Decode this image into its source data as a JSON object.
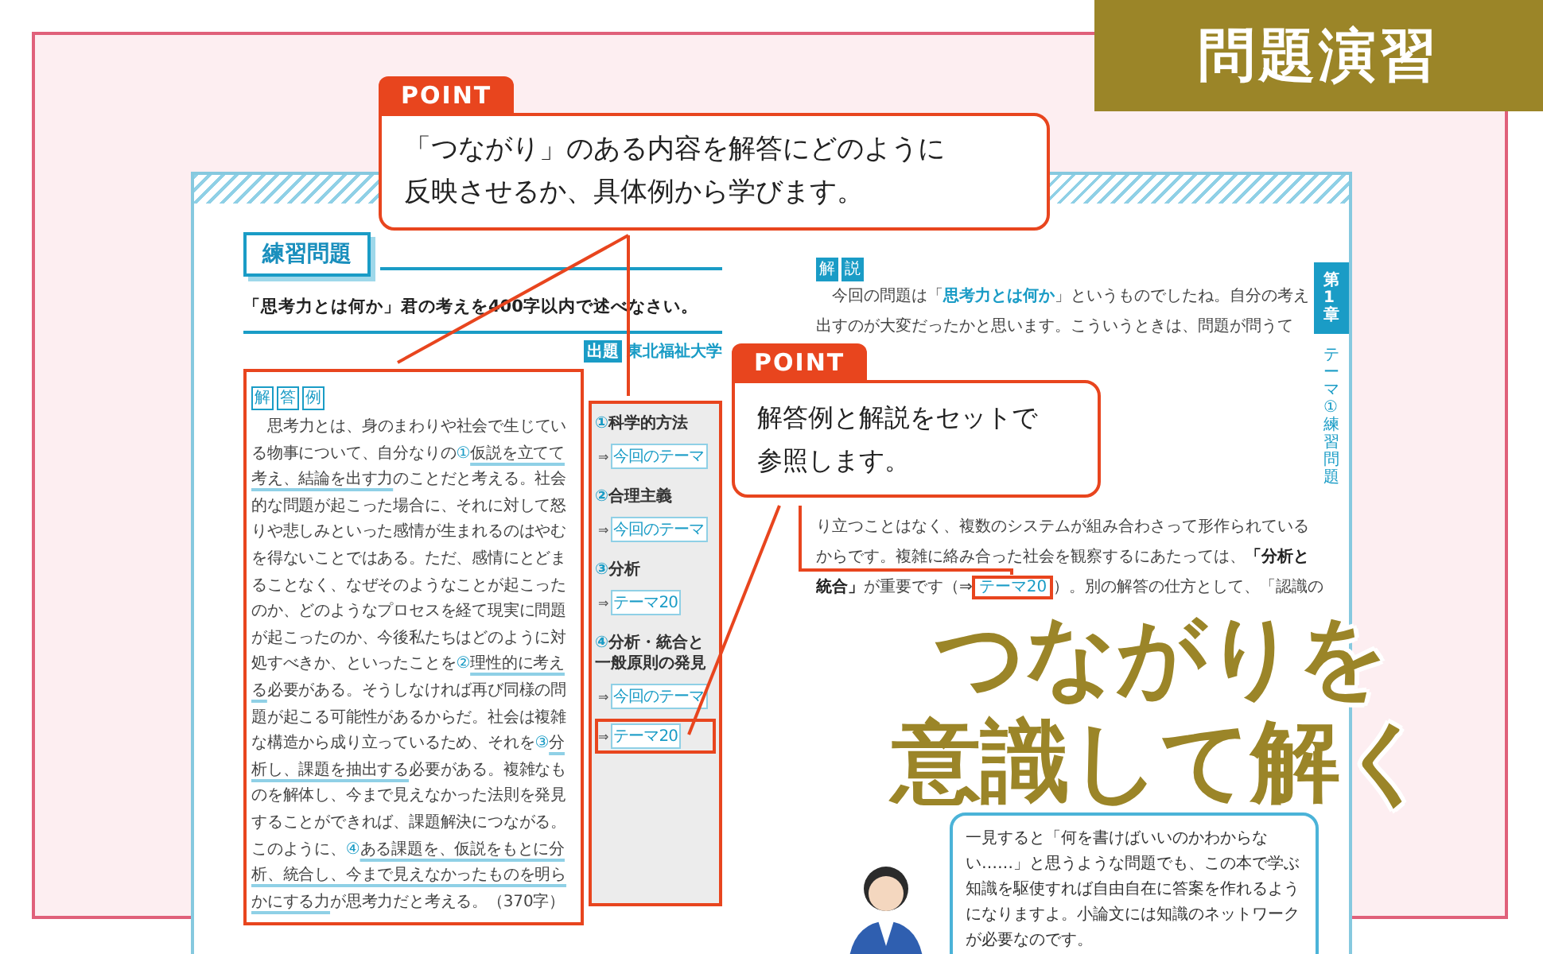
{
  "badge": "問題演習",
  "callouts": [
    {
      "tag": "POINT",
      "lines": [
        "「つながり」のある内容を解答にどのように",
        "反映させるか、具体例から学びます。"
      ]
    },
    {
      "tag": "POINT",
      "lines": [
        "解答例と解説をセットで",
        "参照します。"
      ]
    }
  ],
  "exercise": {
    "heading": "練習問題",
    "question": "「思考力とは何か」君の考えを400字以内で述べなさい。",
    "source_label": "出題",
    "source": "東北福祉大学"
  },
  "answer": {
    "label": "解答例",
    "segments": [
      {
        "kind": "plain",
        "text": "思考力とは、身のまわりや社会で生じている物事について、自分なりの"
      },
      {
        "kind": "number",
        "text": "①"
      },
      {
        "kind": "underline",
        "text": "仮説を立てて考え、結論を出す力"
      },
      {
        "kind": "plain",
        "text": "のことだと考える。社会的な問題が起こった場合に、それに対して怒りや悲しみといった感情が生まれるのはやむを得ないことではある。ただ、感情にとどまることなく、なぜそのようなことが起こったのか、どのようなプロセスを経て現実に問題が起こったのか、今後私たちはどのように対処すべきか、といったことを"
      },
      {
        "kind": "number",
        "text": "②"
      },
      {
        "kind": "underline",
        "text": "理性的に考える"
      },
      {
        "kind": "plain",
        "text": "必要がある。そうしなければ再び同様の問題が起こる可能性があるからだ。社会は複雑な構造から成り立っているため、それを"
      },
      {
        "kind": "number",
        "text": "③"
      },
      {
        "kind": "underline",
        "text": "分析し、課題を抽出する"
      },
      {
        "kind": "plain",
        "text": "必要がある。複雑なものを解体し、今まで見えなかった法則を発見することができれば、課題解決につながる。このように、"
      },
      {
        "kind": "number",
        "text": "④"
      },
      {
        "kind": "underline",
        "text": "ある課題を、仮説をもとに分析、統合し、今まで見えなかったものを明らかにする力"
      },
      {
        "kind": "plain",
        "text": "が思考力だと考える。（370字）"
      }
    ]
  },
  "key_points": [
    {
      "number": "①",
      "label": "科学的方法",
      "refs": [
        {
          "arrow": "⇒",
          "text": "今回のテーマ",
          "highlighted": false
        }
      ]
    },
    {
      "number": "②",
      "label": "合理主義",
      "refs": [
        {
          "arrow": "⇒",
          "text": "今回のテーマ",
          "highlighted": false
        }
      ]
    },
    {
      "number": "③",
      "label": "分析",
      "refs": [
        {
          "arrow": "⇒",
          "text": "テーマ20",
          "highlighted": false
        }
      ]
    },
    {
      "number": "④",
      "label": "分析・統合と一般原則の発見",
      "refs": [
        {
          "arrow": "⇒",
          "text": "今回のテーマ",
          "highlighted": false
        },
        {
          "arrow": "⇒",
          "text": "テーマ20",
          "highlighted": true
        }
      ]
    }
  ],
  "commentary": {
    "label": "解説",
    "lines_top": [
      [
        {
          "kind": "plain",
          "text": "今回の問題は「"
        },
        {
          "kind": "keyword",
          "text": "思考力とは何か"
        },
        {
          "kind": "plain",
          "text": "」というものでしたね。自分の考え"
        }
      ],
      [
        {
          "kind": "plain",
          "text": "出すのが大変だったかと思います。こういうときは、問題が問うて"
        }
      ]
    ],
    "lines_bottom": [
      [
        {
          "kind": "plain",
          "text": "り立つことはなく、複数のシステムが組み合わさって形作られている"
        }
      ],
      [
        {
          "kind": "plain",
          "text": "からです。複雑に絡み合った社会を観察するにあたっては、"
        },
        {
          "kind": "bold",
          "text": "「分析と"
        }
      ],
      [
        {
          "kind": "bold",
          "text": "統合」"
        },
        {
          "kind": "plain",
          "text": "が重要です（⇒"
        },
        {
          "kind": "tag-highlighted",
          "text": "テーマ20"
        },
        {
          "kind": "plain",
          "text": "）。別の解答の仕方として、「認識の"
        }
      ]
    ]
  },
  "slogan": [
    "つながりを",
    "意識して解く"
  ],
  "bubble": "一見すると「何を書けばいいのかわからない……」と思うような問題でも、この本で学ぶ知識を駆使すれば自由自在に答案を作れるようになりますよ。小論文には知識のネットワークが必要なのです。",
  "chapter_tab": "第1章",
  "section_label": "テーマ①練習問題"
}
